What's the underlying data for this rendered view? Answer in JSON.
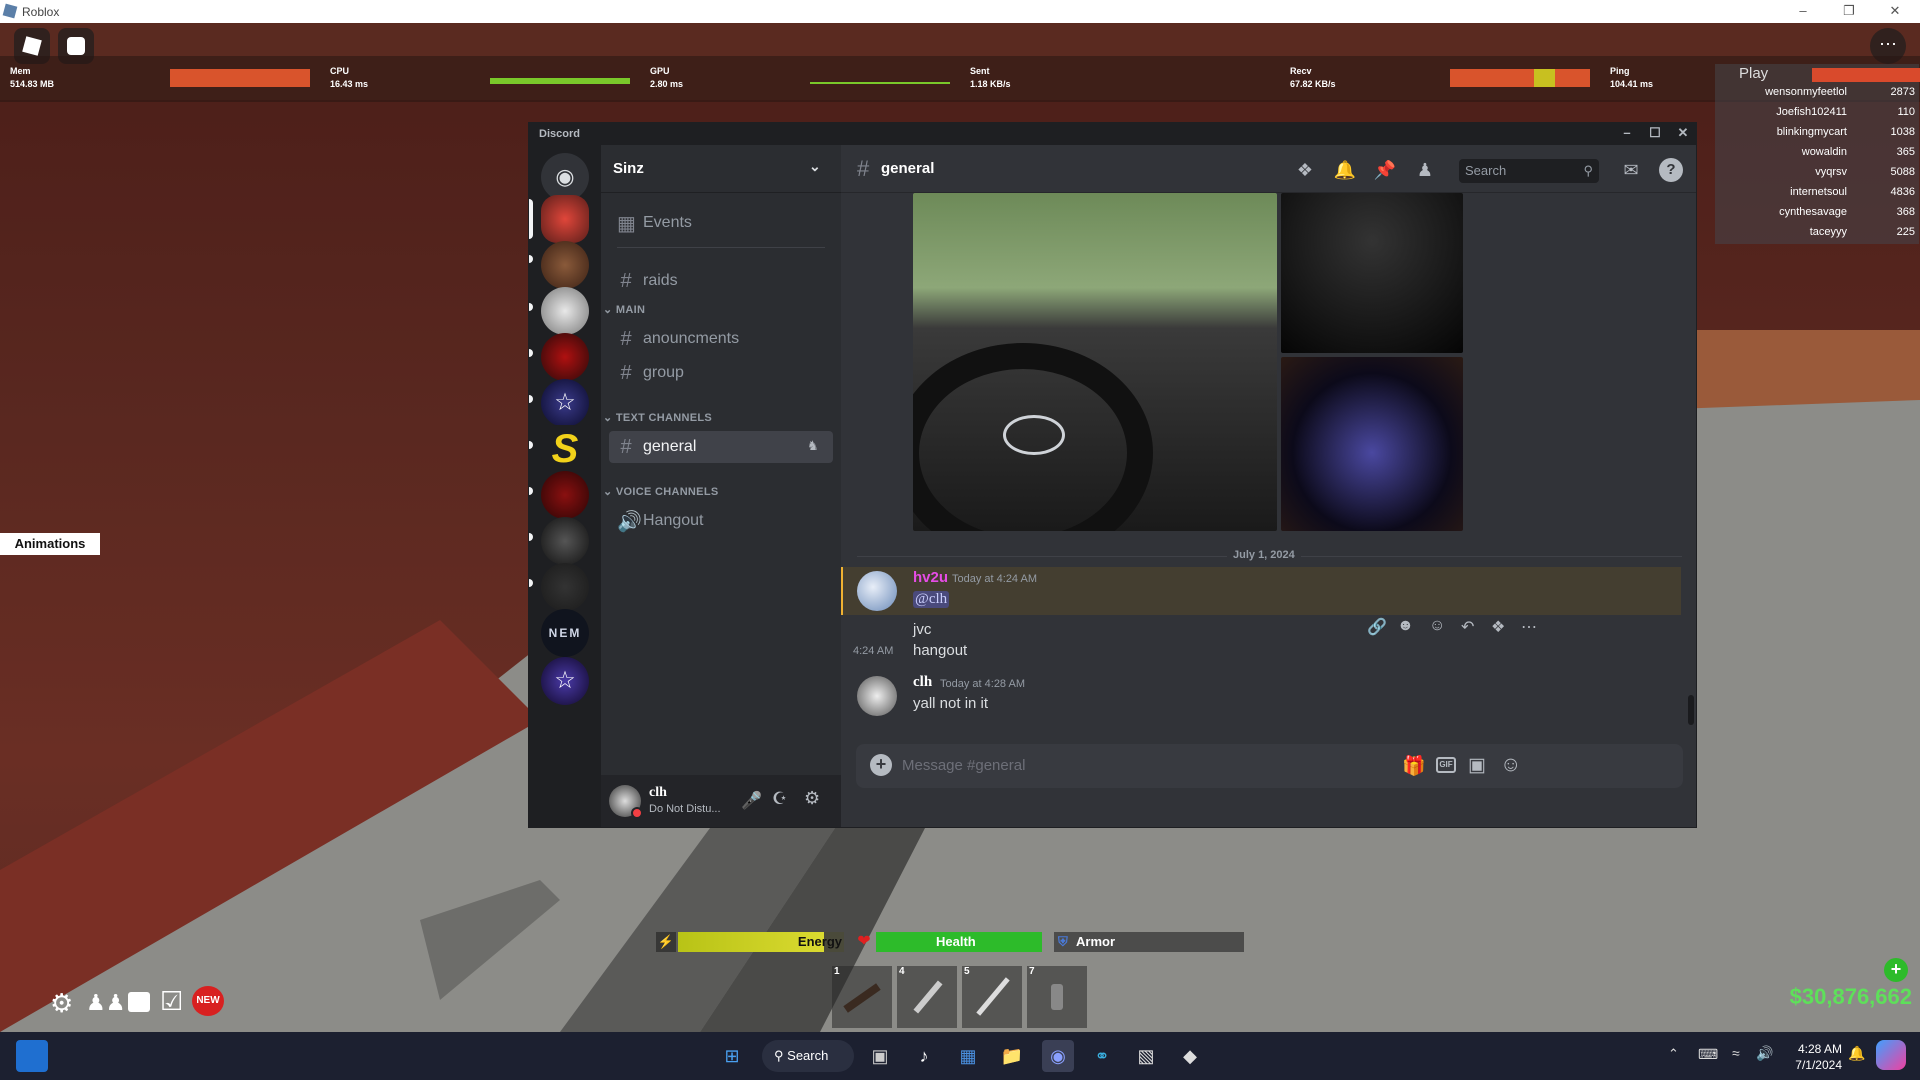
{
  "window": {
    "title": "Roblox"
  },
  "roblox_top": {
    "menu_icon": "roblox-logo-icon",
    "chat_icon": "chat-icon",
    "more_icon": "ellipsis-icon"
  },
  "stats": [
    {
      "label": "Mem",
      "value": "514.83 MB"
    },
    {
      "label": "CPU",
      "value": "16.43 ms"
    },
    {
      "label": "GPU",
      "value": "2.80 ms"
    },
    {
      "label": "Sent",
      "value": "1.18 KB/s"
    },
    {
      "label": "Recv",
      "value": "67.82 KB/s"
    },
    {
      "label": "Ping",
      "value": "104.41 ms"
    }
  ],
  "leaderboard": {
    "header": "Play",
    "rows": [
      {
        "name": "wensonmyfeetlol",
        "score": "2873"
      },
      {
        "name": "Joefish102411",
        "score": "110"
      },
      {
        "name": "blinkingmycart",
        "score": "1038"
      },
      {
        "name": "wowaldin",
        "score": "365"
      },
      {
        "name": "vyqrsv",
        "score": "5088"
      },
      {
        "name": "internetsoul",
        "score": "4836"
      },
      {
        "name": "cynthesavage",
        "score": "368"
      },
      {
        "name": "taceyyy",
        "score": "225"
      }
    ]
  },
  "animations_label": "Animations",
  "discord": {
    "app_title": "Discord",
    "server_name": "Sinz",
    "channels": {
      "events": "Events",
      "raids": "raids",
      "cat_main": "MAIN",
      "anouncments": "anouncments",
      "group": "group",
      "cat_text": "TEXT CHANNELS",
      "general": "general",
      "cat_voice": "VOICE CHANNELS",
      "hangout": "Hangout"
    },
    "user": {
      "name": "clh",
      "status": "Do Not Distu..."
    },
    "chat": {
      "channel": "general",
      "search_placeholder": "Search",
      "date_divider": "July 1, 2024",
      "messages": [
        {
          "author": "hv2u",
          "time": "Today at 4:24 AM",
          "mention": "@clh",
          "line1": "jvc",
          "side_time": "4:24 AM",
          "line2": "hangout"
        },
        {
          "author": "clh",
          "time": "Today at 4:28 AM",
          "line1": "yall not in it"
        }
      ],
      "input_placeholder": "Message #general",
      "gif_label": "GIF"
    }
  },
  "hud": {
    "energy": "Energy",
    "energy_level": 0.88,
    "health": "Health",
    "health_level": 1.0,
    "armor": "Armor",
    "armor_level": 0,
    "slots": [
      "1",
      "4",
      "5",
      "7"
    ],
    "money": "$30,876,662",
    "bottom_icons": [
      "gear-icon",
      "group-icon",
      "inventory-icon",
      "checklist-icon",
      "new-badge-icon"
    ],
    "new_badge": "NEW"
  },
  "taskbar": {
    "search": "Search",
    "time": "4:28 AM",
    "date": "7/1/2024"
  },
  "colors": {
    "discord_bg": "#313338",
    "energy": "#b8c316",
    "health": "#2dbb2a",
    "money": "#5ee05a",
    "accent_red": "#d94a2c"
  }
}
